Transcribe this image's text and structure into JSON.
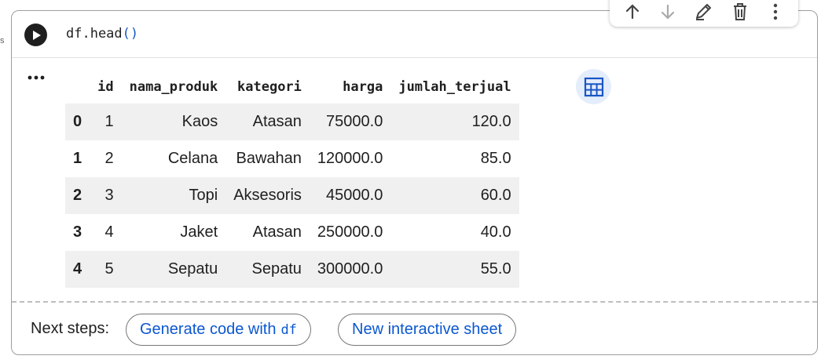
{
  "left_marker": "s",
  "cell": {
    "code": {
      "fn": "df.head",
      "parens": "()"
    },
    "toolbar": {
      "items": [
        "move-up",
        "move-down",
        "edit",
        "delete",
        "more"
      ]
    }
  },
  "dataframe": {
    "columns": [
      "id",
      "nama_produk",
      "kategori",
      "harga",
      "jumlah_terjual"
    ],
    "rows": [
      {
        "index": "0",
        "cells": [
          "1",
          "Kaos",
          "Atasan",
          "75000.0",
          "120.0"
        ]
      },
      {
        "index": "1",
        "cells": [
          "2",
          "Celana",
          "Bawahan",
          "120000.0",
          "85.0"
        ]
      },
      {
        "index": "2",
        "cells": [
          "3",
          "Topi",
          "Aksesoris",
          "45000.0",
          "60.0"
        ]
      },
      {
        "index": "3",
        "cells": [
          "4",
          "Jaket",
          "Atasan",
          "250000.0",
          "40.0"
        ]
      },
      {
        "index": "4",
        "cells": [
          "5",
          "Sepatu",
          "Sepatu",
          "300000.0",
          "55.0"
        ]
      }
    ]
  },
  "next_steps": {
    "label": "Next steps:",
    "generate_label": "Generate code with",
    "generate_var": "df",
    "interactive_label": "New interactive sheet"
  },
  "colors": {
    "accent": "#0b57d0",
    "row_stripe": "#f0f0f0",
    "icon_bg": "#e4edfb"
  }
}
